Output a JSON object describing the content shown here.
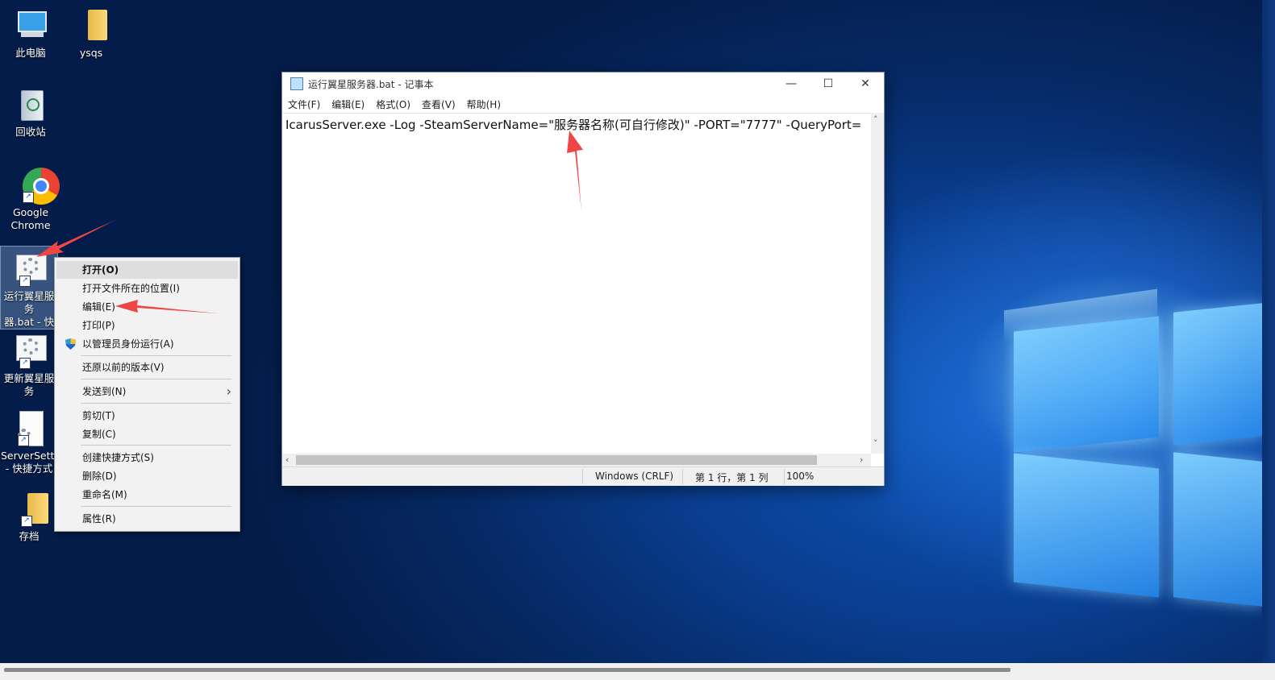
{
  "desktop": {
    "icons": [
      {
        "label": "此电脑",
        "icon": "computer-icon"
      },
      {
        "label": "ysqs",
        "icon": "folder-icon"
      },
      {
        "label": "回收站",
        "icon": "recycle-bin-icon"
      },
      {
        "label": "Google Chrome",
        "icon": "chrome-icon"
      },
      {
        "label": "运行翼星服务器.bat - 快捷方式",
        "label_visible": "运行翼星服务\n器.bat - 快捷\n方式",
        "icon": "gear-file-icon"
      },
      {
        "label": "更新翼星服务器.bat - 快...",
        "label_visible": "更新翼星服务\n器.bat - 快...",
        "icon": "gear-file-icon"
      },
      {
        "label": "ServerSett... - 快捷方式",
        "icon": "settings-file-icon"
      },
      {
        "label": "存档",
        "icon": "folder-icon"
      }
    ]
  },
  "notepad": {
    "title": "运行翼星服务器.bat - 记事本",
    "controls": {
      "minimize": "—",
      "maximize": "☐",
      "close": "✕"
    },
    "menu": [
      "文件(F)",
      "编辑(E)",
      "格式(O)",
      "查看(V)",
      "帮助(H)"
    ],
    "content": "IcarusServer.exe -Log -SteamServerName=\"服务器名称(可自行修改)\" -PORT=\"7777\" -QueryPort=",
    "status": {
      "encoding": "Windows (CRLF)",
      "position": "第 1 行，第 1 列",
      "zoom": "100%"
    }
  },
  "context_menu": {
    "items": [
      {
        "label": "打开(O)",
        "highlighted": true
      },
      {
        "label": "打开文件所在的位置(I)"
      },
      {
        "label": "编辑(E)"
      },
      {
        "label": "打印(P)"
      },
      {
        "label": "以管理员身份运行(A)",
        "icon": "uac-shield-icon"
      },
      {
        "label": "还原以前的版本(V)"
      },
      {
        "label": "发送到(N)",
        "submenu": "›"
      },
      {
        "label": "剪切(T)"
      },
      {
        "label": "复制(C)"
      },
      {
        "label": "创建快捷方式(S)"
      },
      {
        "label": "删除(D)"
      },
      {
        "label": "重命名(M)"
      },
      {
        "label": "属性(R)"
      }
    ]
  },
  "colors": {
    "accent_arrow": "#f04545",
    "desktop_bg": "#0a3f92",
    "menu_bg": "#f2f2f2"
  }
}
